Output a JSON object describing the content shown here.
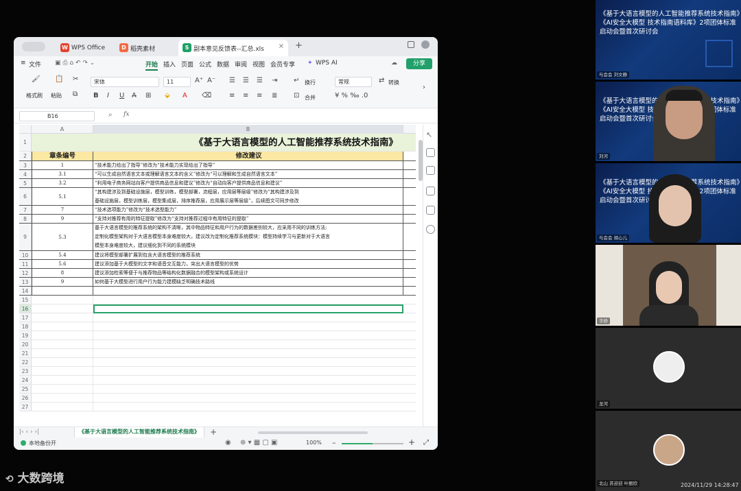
{
  "wps": {
    "tabs": [
      {
        "label": "WPS Office",
        "icon": "W"
      },
      {
        "label": "稻壳素材",
        "icon": "D"
      },
      {
        "label": "副本意见反馈表--汇总.xls",
        "icon": "S"
      }
    ],
    "menu": {
      "file": "文件",
      "items": [
        "开始",
        "插入",
        "页面",
        "公式",
        "数据",
        "审阅",
        "视图",
        "会员专享"
      ],
      "wps_ai": "WPS AI",
      "share": "分享"
    },
    "ribbon": {
      "format_painter": "格式刷",
      "paste": "粘贴",
      "font_name": "宋体",
      "font_size": "11",
      "wrap": "换行",
      "merge": "合并",
      "number_format": "常规",
      "convert": "转换"
    },
    "formula_bar": {
      "cell_ref": "B16",
      "fx": "fx"
    },
    "sheet": {
      "col_a": "A",
      "col_b": "B",
      "title": "《基于大语言模型的人工智能推荐系统技术指南》",
      "header_a": "章条编号",
      "header_b": "修改建议",
      "rows": [
        {
          "num": "1",
          "a": "",
          "b": ""
        },
        {
          "num": "2",
          "a": "",
          "b": ""
        },
        {
          "num": "3",
          "a": "1",
          "b": "“技术能力给出了指导”修改为“技术能力实现给出了指导”"
        },
        {
          "num": "4",
          "a": "3.1",
          "b": "“可以生成自然语言文本或理解语言文本的含义”修改为“可以理解和生成自然语言文本”"
        },
        {
          "num": "5",
          "a": "3.2",
          "b": "“利用电子商务网站向客户提供商品信息和建议”修改为“自动向客户提供商品信息和建议”"
        },
        {
          "num": "6",
          "a": "5.1",
          "b": "“其构建涉及到基础设施层，模型训练，模型部署，流程层，应用层等层级”修改为“其构建涉及到 | 基础设施层，模型训练层，模型集成层，排序推荐层，应用展示层等层级”，后续图文可同步修改"
        },
        {
          "num": "7",
          "a": "7",
          "b": "“技术选项能力”修改为“技术选型能力”"
        },
        {
          "num": "8",
          "a": "9",
          "b": "“支持对推荐有用的特征提取”修改为“支持对推荐过程中有用特征的提取”"
        },
        {
          "num": "9",
          "a": "5.3",
          "b": "基于大语言模型的推荐系统的架构不清晰，其中物品特征和用户行为的数据差别较大，应采用不同的训练方法; | 定制化模型架构对于大语言模型本身难度较大，建议改为定制化推荐系统模块：模型持续学习与更新对于大语言 | 模型本身难度较大，建议细化到不同的系统模块"
        },
        {
          "num": "10",
          "a": "5.4",
          "b": "建议将模型部署扩展到包含大语言模型的推荐系统"
        },
        {
          "num": "11",
          "a": "5.6",
          "b": "建议添加基于大模型的文字和语音交互能力，突出大语言模型的优势"
        },
        {
          "num": "12",
          "a": "8",
          "b": "建议添加检索等便于与推荐物品等结构化数据融合的模型架构或系统设计"
        },
        {
          "num": "13",
          "a": "9",
          "b": "如何基于大模型进行用户行为能力建模缺乏明确技术路线"
        },
        {
          "num": "14",
          "a": "",
          "b": ""
        },
        {
          "num": "15",
          "a": "",
          "b": ""
        },
        {
          "num": "16",
          "a": "",
          "b": ""
        },
        {
          "num": "17",
          "a": "",
          "b": ""
        },
        {
          "num": "18",
          "a": "",
          "b": ""
        },
        {
          "num": "19",
          "a": "",
          "b": ""
        },
        {
          "num": "20",
          "a": "",
          "b": ""
        },
        {
          "num": "21",
          "a": "",
          "b": ""
        },
        {
          "num": "22",
          "a": "",
          "b": ""
        },
        {
          "num": "23",
          "a": "",
          "b": ""
        },
        {
          "num": "24",
          "a": "",
          "b": ""
        },
        {
          "num": "25",
          "a": "",
          "b": ""
        },
        {
          "num": "26",
          "a": "",
          "b": ""
        },
        {
          "num": "27",
          "a": "",
          "b": ""
        }
      ]
    },
    "sheet_tab": "《基于大语言模型的人工智能推荐系统技术指南》",
    "status": {
      "backup": "本地备份开",
      "zoom": "100%"
    }
  },
  "meeting": {
    "slide_title_lines": [
      "《基于大语言模型的人工智能推荐系统技术指南》",
      "《AI安全大模型 技术指南语料库》2项团体标准",
      "启动会暨首次研讨会"
    ],
    "participants": [
      {
        "name": "与会会 刘文静"
      },
      {
        "name": "刘河"
      },
      {
        "name": "与会会 胡心儿"
      },
      {
        "name": "李静"
      },
      {
        "name": "龙河"
      },
      {
        "name": "北山 苏迎迎 叶丽欣"
      }
    ],
    "timestamp": "2024/11/29 14:28:47"
  },
  "watermark": "大数跨境"
}
